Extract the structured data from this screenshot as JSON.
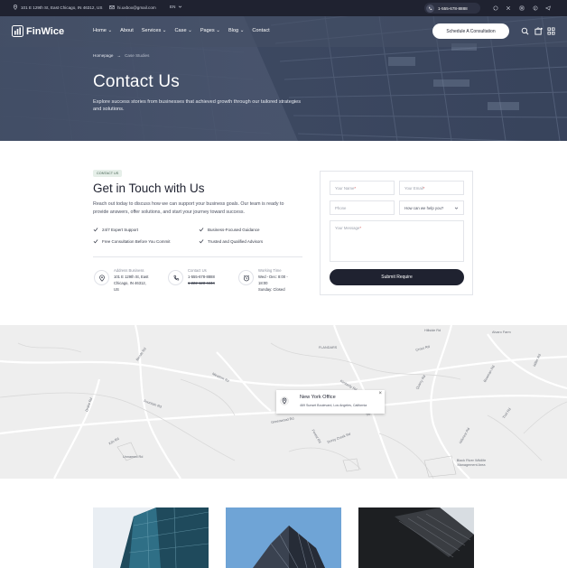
{
  "topbar": {
    "address": "101 E 129th St, East Chicago, IN 46312, US",
    "email": "hi.uxbox@gmail.com",
    "language": "EN",
    "phone": "1-555-678-8888"
  },
  "nav": {
    "logo": "FinWice",
    "items": [
      {
        "label": "Home",
        "has_dropdown": true
      },
      {
        "label": "About",
        "has_dropdown": false
      },
      {
        "label": "Services",
        "has_dropdown": true
      },
      {
        "label": "Case",
        "has_dropdown": true
      },
      {
        "label": "Pages",
        "has_dropdown": true
      },
      {
        "label": "Blog",
        "has_dropdown": true
      },
      {
        "label": "Contact",
        "has_dropdown": false
      }
    ],
    "cta": "Schedule A Consultation"
  },
  "hero": {
    "breadcrumb_home": "Homepage",
    "breadcrumb_sep": "→",
    "breadcrumb_current": "Case Studies",
    "title": "Contact Us",
    "subtitle": "Explore success stories from businesses that achieved growth through our tailored strategies and solutions."
  },
  "contact": {
    "tag": "CONTACT US",
    "heading": "Get in Touch with Us",
    "description": "Reach out today to discuss how we can support your business goals. Our team is ready to provide answers, offer solutions, and start your journey toward success.",
    "features": [
      "24/7 Expert Support",
      "Business-Focused Guidance",
      "Free Consultation Before You Commit",
      "Trusted and Qualified Advisors"
    ],
    "address": {
      "label": "Address Business",
      "line1": "101 E 129th St, East",
      "line2": "Chicago, IN 46312,",
      "line3": "US"
    },
    "phone": {
      "label": "Contact Us",
      "line1": "1-555-678-8888",
      "line2": "1-222-123-4444"
    },
    "hours": {
      "label": "Working Time",
      "line1": "Wed - Dec: 8:00 -",
      "line2": "18:00",
      "line3": "Sunday: Closed"
    }
  },
  "form": {
    "name_placeholder": "Your Name",
    "email_placeholder": "Your Email",
    "phone_placeholder": "Phone",
    "select_value": "How can we help you?",
    "message_placeholder": "Your Message",
    "required_mark": "*",
    "submit": "Submit Require"
  },
  "map": {
    "office_title": "New York Office",
    "office_address": "469 Sunset Boulevard, Los Angeles, California",
    "close": "×",
    "labels": [
      "FLANDARS",
      "Hillside Rd",
      "Alvaro Farm",
      "Bends Rd",
      "Fountain Rd",
      "Kimberly Rd",
      "Drake Rd",
      "Unnamed Rd",
      "Cross Rd",
      "Kiln Rd",
      "Quarry Rd",
      "Bowman Rd",
      "Greenwood Rd",
      "Spring Rd",
      "Miller Rd",
      "Trail Rd",
      "Black River Wildlife Management Area",
      "Dorsy Creek Rd",
      "Forest Rd",
      "Hillcrest Rd",
      "Meadow Rd"
    ]
  },
  "colors": {
    "dark": "#1f2230",
    "tag_bg": "#e6efe9",
    "tag_text": "#3e5c4b",
    "required": "#d14b4b"
  }
}
